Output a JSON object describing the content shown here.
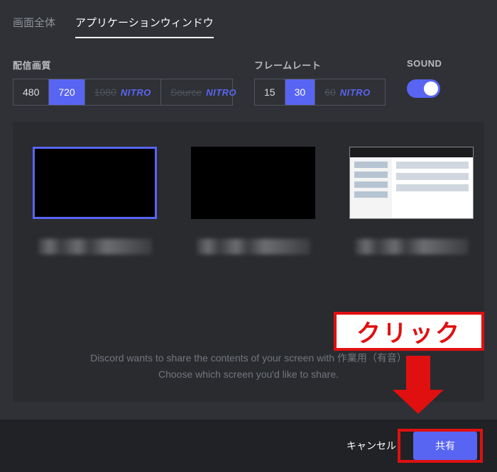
{
  "tabs": {
    "full_screen": "画面全体",
    "app_window": "アプリケーションウィンドウ"
  },
  "settings": {
    "quality": {
      "label": "配信画質",
      "options": [
        "480",
        "720"
      ],
      "nitro_options": [
        "1080",
        "Source"
      ],
      "selected": "720"
    },
    "fps": {
      "label": "フレームレート",
      "options": [
        "15",
        "30"
      ],
      "nitro_options": [
        "60"
      ],
      "selected": "30"
    },
    "sound": {
      "label": "SOUND",
      "enabled": true
    },
    "nitro_badge": "NITRO"
  },
  "help": {
    "line1": "Discord wants to share the contents of your screen with 作業用（有音）",
    "line2": "Choose which screen you'd like to share."
  },
  "footer": {
    "cancel": "キャンセル",
    "share": "共有"
  },
  "annotation": {
    "click_label": "クリック"
  }
}
